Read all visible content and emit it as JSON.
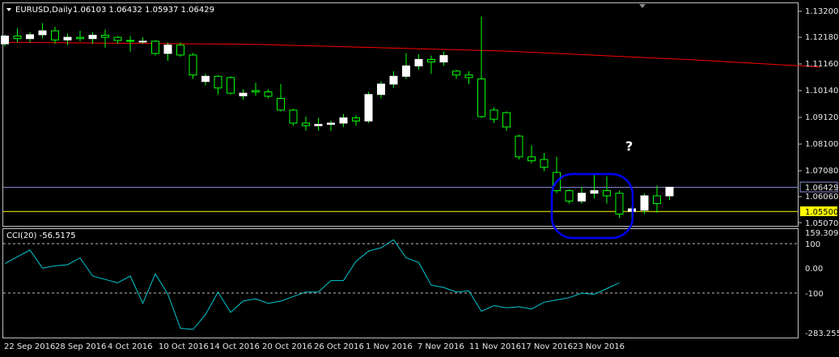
{
  "header": {
    "symbol_label": "EURUSD,Daily",
    "ohlc_label": "1.06103 1.06432 1.05937 1.06429"
  },
  "price_panel": {
    "y_ticks": [
      "1.13200",
      "1.12180",
      "1.11160",
      "1.10140",
      "1.09120",
      "1.08100",
      "1.07080",
      "1.06060",
      "1.05070"
    ],
    "current_price_label": "1.06429",
    "support_label": "1.05500",
    "annotation": "?"
  },
  "cci_panel": {
    "title": "CCI(20) -56.5175",
    "y_ticks": [
      "159.3097",
      "100",
      "0.00",
      "-100",
      "-283.2553"
    ]
  },
  "x_axis": {
    "date_labels": [
      "22 Sep 2016",
      "28 Sep 2016",
      "4 Oct 2016",
      "10 Oct 2016",
      "14 Oct 2016",
      "20 Oct 2016",
      "26 Oct 2016",
      "1 Nov 2016",
      "7 Nov 2016",
      "11 Nov 2016",
      "17 Nov 2016",
      "23 Nov 2016"
    ]
  },
  "colors": {
    "background": "#000000",
    "bull_candle": "#ffffff",
    "bear_candle": "#000000",
    "wick": "#00ff00",
    "moving_average": "#ff0000",
    "cci_line": "#00c8d2",
    "support_line": "#ffff00",
    "current_price_line": "#8a8fd8",
    "highlight_ellipse": "#0000ff",
    "axis_text": "#e8e8e8"
  },
  "chart_data": [
    {
      "type": "candlestick",
      "title": "EURUSD,Daily",
      "ylim": [
        1.0507,
        1.132
      ],
      "horizontal_lines": [
        {
          "label": "1.06429",
          "value": 1.06429
        },
        {
          "label": "1.05500",
          "value": 1.055
        }
      ],
      "moving_average": [
        {
          "index": 0,
          "value": 1.1201
        },
        {
          "index": 20,
          "value": 1.1193
        },
        {
          "index": 40,
          "value": 1.1167
        },
        {
          "index": 55,
          "value": 1.1133
        },
        {
          "index": 65,
          "value": 1.1106
        }
      ],
      "candles": [
        {
          "date": "21 Sep 2016",
          "open": 1.1195,
          "high": 1.123,
          "low": 1.1185,
          "close": 1.1225
        },
        {
          "date": "22 Sep 2016",
          "open": 1.1225,
          "high": 1.1255,
          "low": 1.12,
          "close": 1.1215
        },
        {
          "date": "23 Sep 2016",
          "open": 1.1215,
          "high": 1.124,
          "low": 1.12,
          "close": 1.123
        },
        {
          "date": "26 Sep 2016",
          "open": 1.123,
          "high": 1.1275,
          "low": 1.1215,
          "close": 1.1245
        },
        {
          "date": "27 Sep 2016",
          "open": 1.1245,
          "high": 1.126,
          "low": 1.1195,
          "close": 1.121
        },
        {
          "date": "28 Sep 2016",
          "open": 1.121,
          "high": 1.1235,
          "low": 1.119,
          "close": 1.122
        },
        {
          "date": "29 Sep 2016",
          "open": 1.122,
          "high": 1.1245,
          "low": 1.1205,
          "close": 1.1215
        },
        {
          "date": "30 Sep 2016",
          "open": 1.1215,
          "high": 1.124,
          "low": 1.1195,
          "close": 1.1228
        },
        {
          "date": "3 Oct 2016",
          "open": 1.1228,
          "high": 1.125,
          "low": 1.118,
          "close": 1.122
        },
        {
          "date": "4 Oct 2016",
          "open": 1.122,
          "high": 1.1225,
          "low": 1.1195,
          "close": 1.1208
        },
        {
          "date": "5 Oct 2016",
          "open": 1.1208,
          "high": 1.1225,
          "low": 1.1165,
          "close": 1.1205
        },
        {
          "date": "6 Oct 2016",
          "open": 1.1205,
          "high": 1.122,
          "low": 1.1195,
          "close": 1.1205
        },
        {
          "date": "7 Oct 2016",
          "open": 1.1205,
          "high": 1.121,
          "low": 1.115,
          "close": 1.1158
        },
        {
          "date": "10 Oct 2016",
          "open": 1.1158,
          "high": 1.12,
          "low": 1.113,
          "close": 1.119
        },
        {
          "date": "11 Oct 2016",
          "open": 1.119,
          "high": 1.12,
          "low": 1.1145,
          "close": 1.1152
        },
        {
          "date": "12 Oct 2016",
          "open": 1.1152,
          "high": 1.116,
          "low": 1.106,
          "close": 1.1075
        },
        {
          "date": "13 Oct 2016",
          "open": 1.105,
          "high": 1.108,
          "low": 1.1035,
          "close": 1.107
        },
        {
          "date": "14 Oct 2016",
          "open": 1.107,
          "high": 1.1075,
          "low": 1.1,
          "close": 1.1025
        },
        {
          "date": "17 Oct 2016",
          "open": 1.1065,
          "high": 1.107,
          "low": 1.1,
          "close": 1.1005
        },
        {
          "date": "18 Oct 2016",
          "open": 1.0995,
          "high": 1.102,
          "low": 1.098,
          "close": 1.1005
        },
        {
          "date": "19 Oct 2016",
          "open": 1.1015,
          "high": 1.1045,
          "low": 1.0995,
          "close": 1.101
        },
        {
          "date": "20 Oct 2016",
          "open": 1.101,
          "high": 1.102,
          "low": 1.0985,
          "close": 1.0993
        },
        {
          "date": "21 Oct 2016",
          "open": 1.0985,
          "high": 1.104,
          "low": 1.0935,
          "close": 1.094
        },
        {
          "date": "24 Oct 2016",
          "open": 1.094,
          "high": 1.0945,
          "low": 1.088,
          "close": 1.089
        },
        {
          "date": "25 Oct 2016",
          "open": 1.089,
          "high": 1.0915,
          "low": 1.086,
          "close": 1.088
        },
        {
          "date": "26 Oct 2016",
          "open": 1.088,
          "high": 1.091,
          "low": 1.086,
          "close": 1.0885
        },
        {
          "date": "27 Oct 2016",
          "open": 1.0885,
          "high": 1.09,
          "low": 1.086,
          "close": 1.089
        },
        {
          "date": "28 Oct 2016",
          "open": 1.089,
          "high": 1.0925,
          "low": 1.0875,
          "close": 1.091
        },
        {
          "date": "31 Oct 2016",
          "open": 1.091,
          "high": 1.092,
          "low": 1.088,
          "close": 1.0898
        },
        {
          "date": "1 Nov 2016",
          "open": 1.0898,
          "high": 1.101,
          "low": 1.089,
          "close": 1.1
        },
        {
          "date": "2 Nov 2016",
          "open": 1.1,
          "high": 1.105,
          "low": 1.0985,
          "close": 1.104
        },
        {
          "date": "3 Nov 2016",
          "open": 1.104,
          "high": 1.109,
          "low": 1.1025,
          "close": 1.107
        },
        {
          "date": "4 Nov 2016",
          "open": 1.107,
          "high": 1.116,
          "low": 1.106,
          "close": 1.111
        },
        {
          "date": "7 Nov 2016",
          "open": 1.111,
          "high": 1.1155,
          "low": 1.1095,
          "close": 1.1135
        },
        {
          "date": "8 Nov 2016",
          "open": 1.1135,
          "high": 1.115,
          "low": 1.108,
          "close": 1.1125
        },
        {
          "date": "9 Nov 2016",
          "open": 1.1125,
          "high": 1.1165,
          "low": 1.111,
          "close": 1.115
        },
        {
          "date": "10 Nov 2016",
          "open": 1.109,
          "high": 1.1095,
          "low": 1.106,
          "close": 1.1075
        },
        {
          "date": "11 Nov 2016",
          "open": 1.1075,
          "high": 1.109,
          "low": 1.104,
          "close": 1.1065
        },
        {
          "date": "14 Nov 2016",
          "open": 1.106,
          "high": 1.13,
          "low": 1.091,
          "close": 1.0915
        },
        {
          "date": "15 Nov 2016",
          "open": 1.094,
          "high": 1.095,
          "low": 1.089,
          "close": 1.0905
        },
        {
          "date": "16 Nov 2016",
          "open": 1.093,
          "high": 1.0935,
          "low": 1.086,
          "close": 1.0875
        },
        {
          "date": "17 Nov 2016",
          "open": 1.084,
          "high": 1.0845,
          "low": 1.075,
          "close": 1.076
        },
        {
          "date": "18 Nov 2016",
          "open": 1.076,
          "high": 1.0805,
          "low": 1.0735,
          "close": 1.0745
        },
        {
          "date": "21 Nov 2016",
          "open": 1.075,
          "high": 1.0775,
          "low": 1.0705,
          "close": 1.072
        },
        {
          "date": "22 Nov 2016",
          "open": 1.07,
          "high": 1.076,
          "low": 1.062,
          "close": 1.063
        },
        {
          "date": "23 Nov 2016",
          "open": 1.063,
          "high": 1.0635,
          "low": 1.058,
          "close": 1.059
        },
        {
          "date": "24 Nov 2016",
          "open": 1.059,
          "high": 1.0645,
          "low": 1.058,
          "close": 1.062
        },
        {
          "date": "25 Nov 2016",
          "open": 1.062,
          "high": 1.069,
          "low": 1.06,
          "close": 1.063
        },
        {
          "date": "28 Nov 2016",
          "open": 1.063,
          "high": 1.0685,
          "low": 1.058,
          "close": 1.061
        },
        {
          "date": "29 Nov 2016",
          "open": 1.062,
          "high": 1.063,
          "low": 1.0525,
          "close": 1.054
        },
        {
          "date": "30 Nov 2016",
          "open": 1.055,
          "high": 1.057,
          "low": 1.052,
          "close": 1.056
        },
        {
          "date": "1 Dec 2016",
          "open": 1.0555,
          "high": 1.062,
          "low": 1.054,
          "close": 1.061
        },
        {
          "date": "2 Dec 2016",
          "open": 1.061,
          "high": 1.065,
          "low": 1.0545,
          "close": 1.058
        },
        {
          "date": "5 Dec 2016",
          "open": 1.061,
          "high": 1.0643,
          "low": 1.0594,
          "close": 1.0643
        }
      ]
    },
    {
      "type": "line",
      "title": "CCI(20) -56.5175",
      "ylim": [
        -283.2553,
        159.3097
      ],
      "reference_lines": [
        100,
        -100
      ],
      "values": [
        25,
        55,
        85,
        5,
        15,
        20,
        50,
        -30,
        -45,
        -60,
        -30,
        -150,
        -20,
        -110,
        -260,
        -265,
        -200,
        -100,
        -190,
        -140,
        -130,
        -150,
        -140,
        -120,
        -100,
        -100,
        -50,
        -50,
        35,
        80,
        95,
        130,
        50,
        30,
        -70,
        -80,
        -100,
        -95,
        -185,
        -160,
        -170,
        -165,
        -175,
        -145,
        -135,
        -125,
        -105,
        -110,
        -85,
        -60
      ]
    }
  ]
}
